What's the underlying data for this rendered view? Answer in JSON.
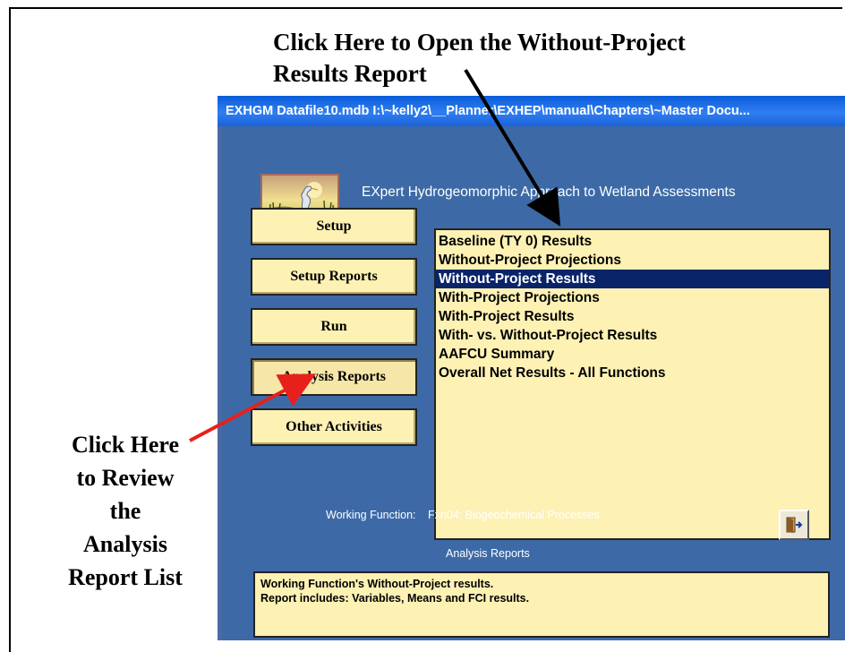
{
  "callouts": {
    "top_line1": "Click Here to Open the Without-Project",
    "top_line2": "Results Report",
    "left_line1": "Click Here",
    "left_line2": "to Review",
    "left_line3": "the",
    "left_line4": "Analysis",
    "left_line5": "Report List"
  },
  "window": {
    "title": "EXHGM   Datafile10.mdb   I:\\~kelly2\\__Planner\\EXHEP\\manual\\Chapters\\~Master Docu..."
  },
  "app": {
    "title": "EXpert Hydrogeomorphic Approach to Wetland Assessments"
  },
  "nav": {
    "setup": "Setup",
    "setup_reports": "Setup Reports",
    "run": "Run",
    "analysis_reports": "Analysis Reports",
    "other_activities": "Other Activities"
  },
  "reports": {
    "items": [
      "Baseline (TY 0) Results",
      "Without-Project Projections",
      "Without-Project Results",
      "With-Project Projections",
      "With-Project Results",
      "With- vs. Without-Project Results",
      "AAFCU Summary",
      "Overall Net Results - All Functions"
    ],
    "selected_index": 2,
    "caption": "Analysis Reports"
  },
  "working_function": {
    "label": "Working Function:",
    "value": "Fxn04: Biogeochemical Processes"
  },
  "description": {
    "line1": "Working Function's Without-Project results.",
    "line2": "Report includes:  Variables, Means and FCI results."
  },
  "colors": {
    "panel_yellow": "#fdf1b4",
    "window_blue": "#3d6aa6",
    "titlebar_blue": "#0a5cd8",
    "selection_navy": "#0a246a",
    "arrow_red": "#e8201c"
  },
  "icons": {
    "exit": "exit-door-icon",
    "logo": "heron-wetland-logo"
  }
}
